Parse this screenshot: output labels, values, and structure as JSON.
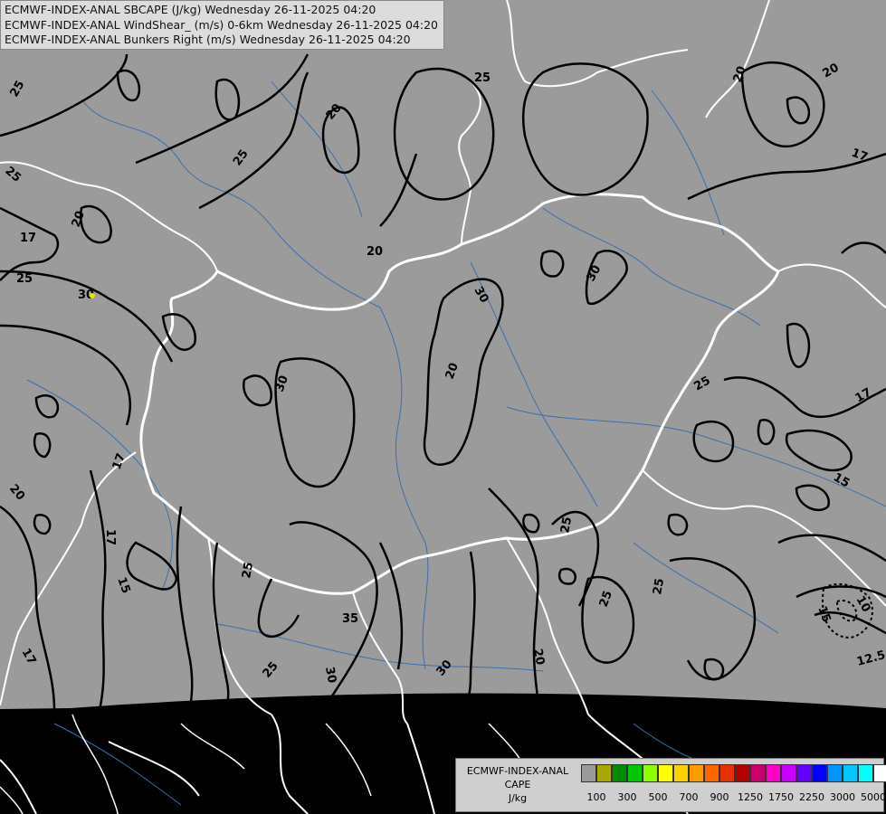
{
  "header": {
    "lines": [
      "ECMWF-INDEX-ANAL SBCAPE (J/kg) Wednesday 26-11-2025 04:20",
      "ECMWF-INDEX-ANAL WindShear_ (m/s) 0-6km Wednesday 26-11-2025 04:20",
      "ECMWF-INDEX-ANAL Bunkers Right (m/s) Wednesday 26-11-2025 04:20"
    ]
  },
  "colors": {
    "background": "#000000",
    "data_area": "#9b9b9b",
    "contour": "#000000",
    "border": "#ffffff",
    "river": "#3a6fb0"
  },
  "colorbar": {
    "title_lines": [
      "ECMWF-INDEX-ANAL",
      "CAPE",
      "J/kg"
    ],
    "swatches": [
      "#9b9b9b",
      "#a8a800",
      "#008c00",
      "#00c800",
      "#8cff00",
      "#ffff00",
      "#ffd000",
      "#ff9c00",
      "#ff6400",
      "#e63200",
      "#b40000",
      "#c8006e",
      "#ff00c8",
      "#c800ff",
      "#6400ff",
      "#0000ff",
      "#0096ff",
      "#00c8ff",
      "#00ffff",
      "#ffffff"
    ],
    "tick_labels": [
      "100",
      "300",
      "500",
      "700",
      "900",
      "1250",
      "1750",
      "2250",
      "3000",
      "5000"
    ]
  },
  "contour_labels": [
    "25",
    "25",
    "20",
    "25",
    "20",
    "25",
    "17",
    "20",
    "25",
    "30",
    "20",
    "30",
    "30",
    "30",
    "20",
    "20",
    "17",
    "17",
    "25",
    "17",
    "15",
    "20",
    "25",
    "17",
    "15",
    "17",
    "25",
    "25",
    "35",
    "30",
    "25",
    "30",
    "20",
    "25",
    "10",
    "15",
    "12.5",
    "20",
    "17",
    "30"
  ]
}
